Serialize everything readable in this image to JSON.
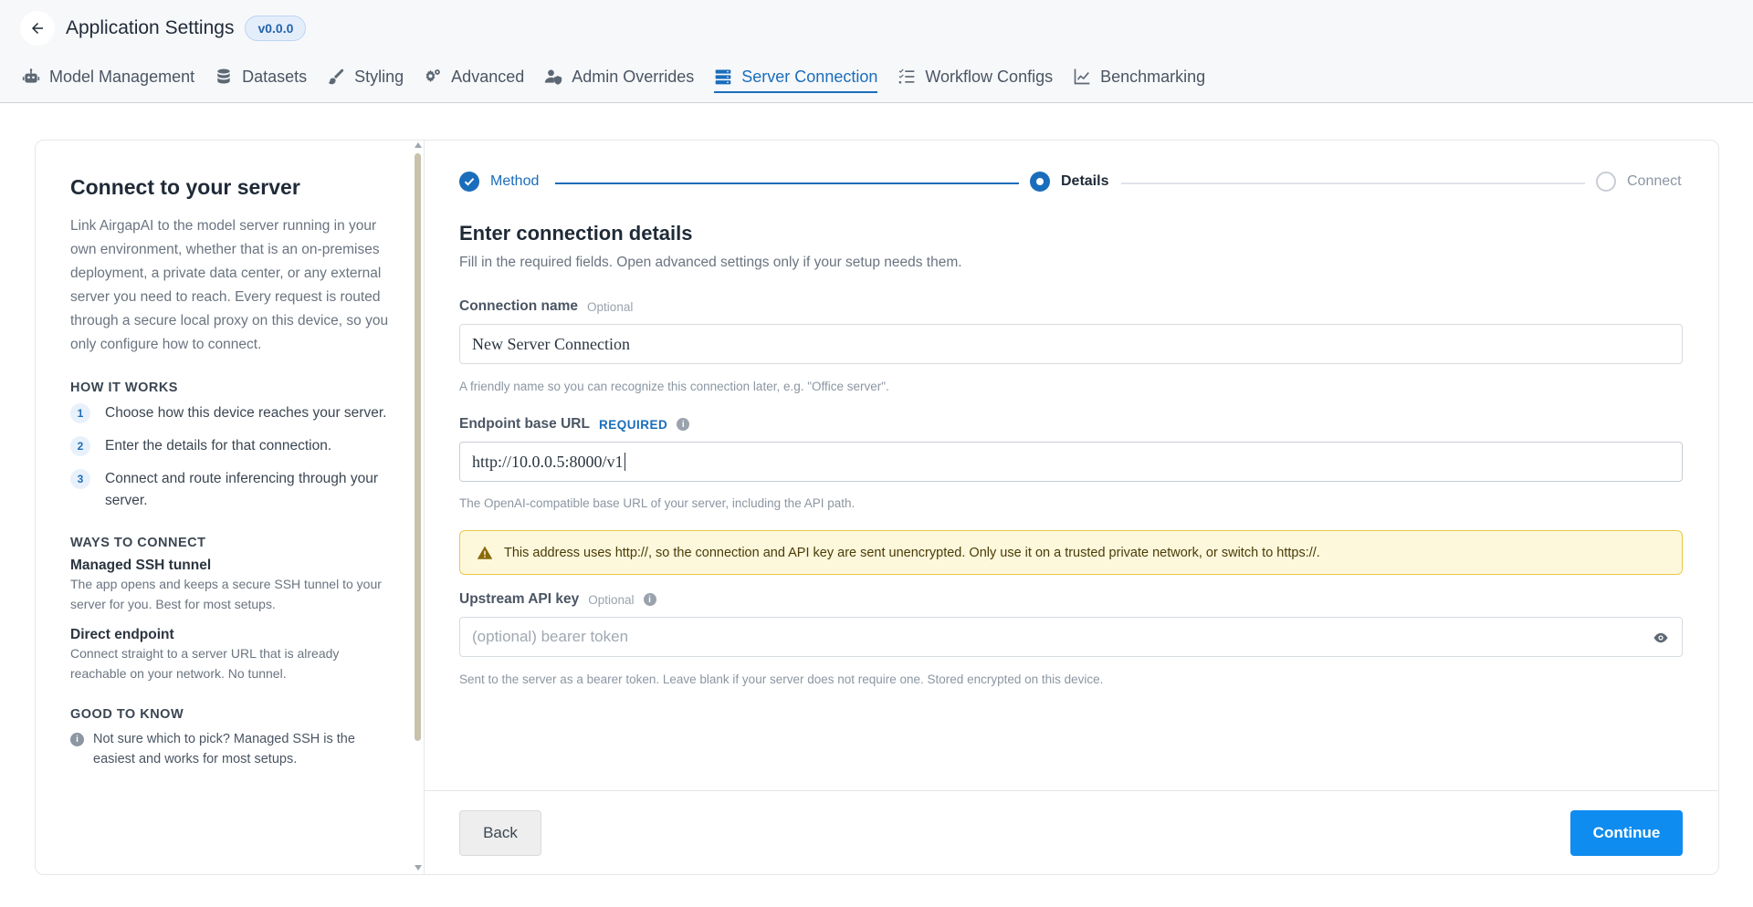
{
  "header": {
    "title": "Application Settings",
    "version": "v0.0.0",
    "tabs": [
      {
        "label": "Model Management",
        "icon": "robot-icon"
      },
      {
        "label": "Datasets",
        "icon": "database-icon"
      },
      {
        "label": "Styling",
        "icon": "brush-icon"
      },
      {
        "label": "Advanced",
        "icon": "gears-icon"
      },
      {
        "label": "Admin Overrides",
        "icon": "user-shield-icon"
      },
      {
        "label": "Server Connection",
        "icon": "server-icon",
        "active": true
      },
      {
        "label": "Workflow Configs",
        "icon": "list-check-icon"
      },
      {
        "label": "Benchmarking",
        "icon": "chart-line-icon"
      }
    ]
  },
  "sidebar": {
    "title": "Connect to your server",
    "intro": "Link AirgapAI to the model server running in your own environment, whether that is an on-premises deployment, a private data center, or any external server you need to reach. Every request is routed through a secure local proxy on this device, so you only configure how to connect.",
    "how_heading": "HOW IT WORKS",
    "steps": [
      {
        "num": "1",
        "text": "Choose how this device reaches your server."
      },
      {
        "num": "2",
        "text": "Enter the details for that connection."
      },
      {
        "num": "3",
        "text": "Connect and route inferencing through your server."
      }
    ],
    "ways_heading": "WAYS TO CONNECT",
    "ways": [
      {
        "title": "Managed SSH tunnel",
        "desc": "The app opens and keeps a secure SSH tunnel to your server for you. Best for most setups."
      },
      {
        "title": "Direct endpoint",
        "desc": "Connect straight to a server URL that is already reachable on your network. No tunnel."
      }
    ],
    "know_heading": "GOOD TO KNOW",
    "tip": "Not sure which to pick? Managed SSH is the easiest and works for most setups."
  },
  "stepper": {
    "steps": [
      "Method",
      "Details",
      "Connect"
    ],
    "current": "Details"
  },
  "form": {
    "title": "Enter connection details",
    "subtitle": "Fill in the required fields. Open advanced settings only if your setup needs them.",
    "name_label": "Connection name",
    "name_optional": "Optional",
    "name_value": "New Server Connection",
    "name_hint": "A friendly name so you can recognize this connection later, e.g. \"Office server\".",
    "url_label": "Endpoint base URL",
    "url_required": "REQUIRED",
    "url_value": "http://10.0.0.5:8000/v1",
    "url_hint": "The OpenAI-compatible base URL of your server, including the API path.",
    "warning": "This address uses http://, so the connection and API key are sent unencrypted. Only use it on a trusted private network, or switch to https://.",
    "key_label": "Upstream API key",
    "key_optional": "Optional",
    "key_placeholder": "(optional) bearer token",
    "key_hint": "Sent to the server as a bearer token. Leave blank if your server does not require one. Stored encrypted on this device."
  },
  "footer": {
    "back_label": "Back",
    "continue_label": "Continue"
  },
  "colors": {
    "accent": "#1a6dbb",
    "primary_button": "#0f8cf0",
    "warning_bg": "#fdf8dc",
    "warning_border": "#e8c94b"
  }
}
